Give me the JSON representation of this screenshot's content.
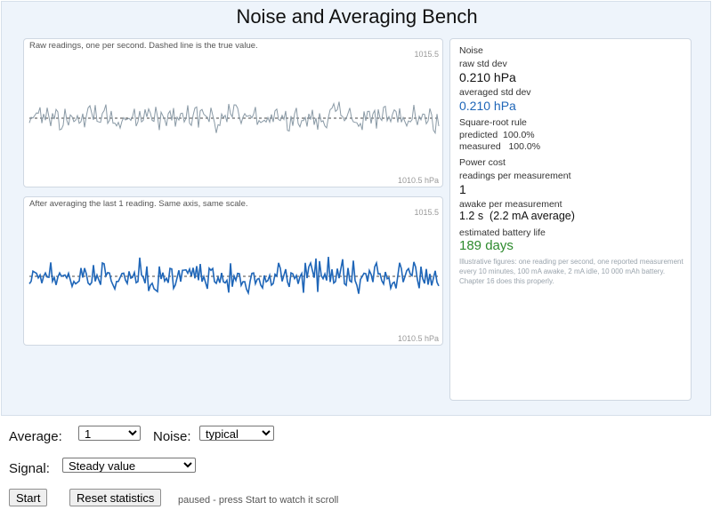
{
  "title": "Noise and Averaging Bench",
  "panels": {
    "raw": {
      "caption": "Raw readings, one per second.  Dashed line is the true value.",
      "axis_top": "1015.5",
      "axis_bottom": "1010.5  hPa",
      "color": "#8a9aa6"
    },
    "averaged": {
      "caption": "After averaging the last 1 reading.  Same axis, same scale.",
      "axis_top": "1015.5",
      "axis_bottom": "1010.5  hPa",
      "color": "#1f66b8"
    }
  },
  "stats": {
    "noise_heading": "Noise",
    "raw_std_label": "raw std dev",
    "raw_std_value": "0.210 hPa",
    "avg_std_label": "averaged std dev",
    "avg_std_value": "0.210 hPa",
    "sqrt_heading": "Square-root rule",
    "predicted": "predicted  100.0%",
    "measured": "measured   100.0%",
    "power_heading": "Power cost",
    "readings_label": "readings per measurement",
    "readings_value": "1",
    "awake_label": "awake per measurement",
    "awake_value": "1.2 s  (2.2 mA average)",
    "battery_label": "estimated battery life",
    "battery_value": "189 days",
    "note": "Illustrative figures: one reading per second, one reported measurement every 10 minutes, 100 mA awake, 2 mA idle, 10 000 mAh battery. Chapter 16 does this properly."
  },
  "controls": {
    "average_label": "Average:",
    "average_value": "1",
    "noise_label": "Noise:",
    "noise_value": "typical",
    "signal_label": "Signal:",
    "signal_value": "Steady value",
    "start_label": "Start",
    "reset_label": "Reset statistics",
    "status": "paused - press Start to watch it scroll"
  }
}
